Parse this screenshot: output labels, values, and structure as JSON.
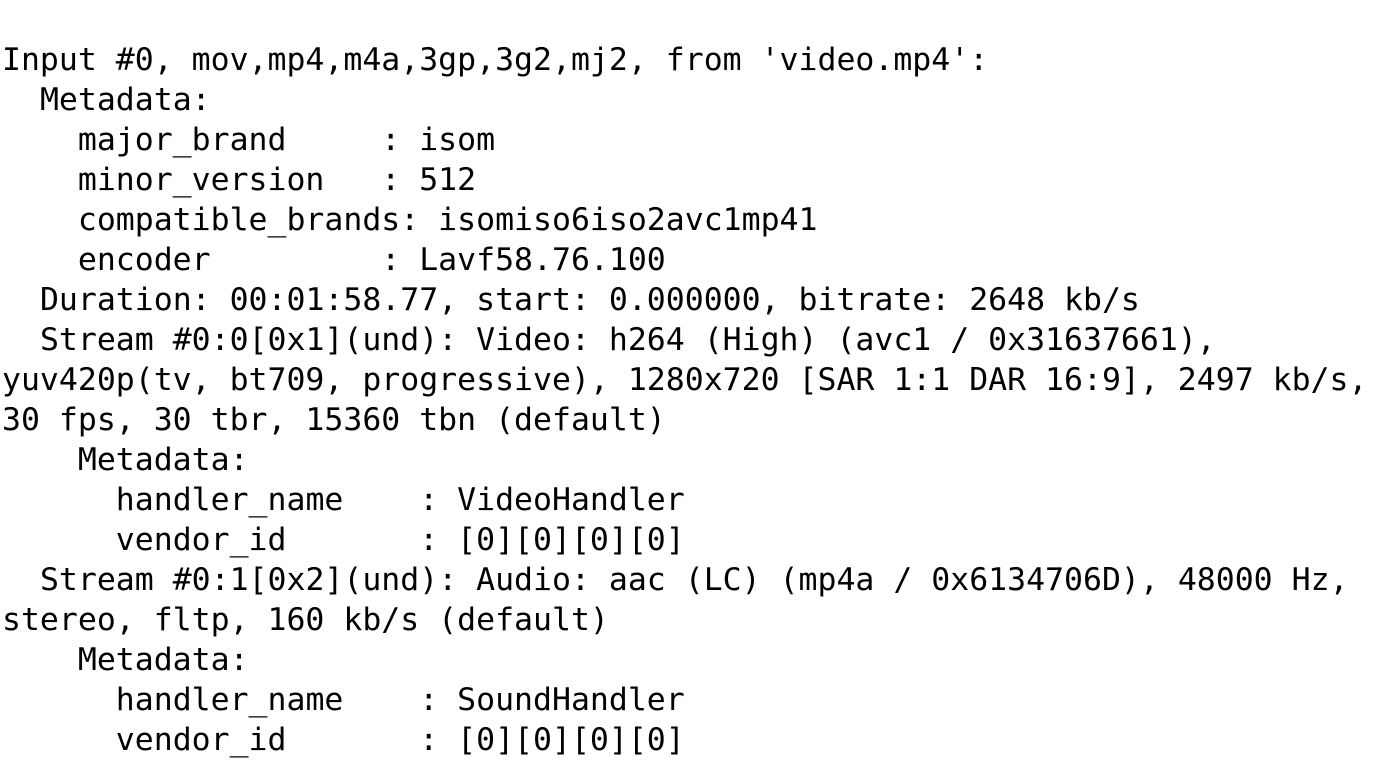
{
  "terminal": {
    "app": "ffprobe",
    "background_color": "#ffffff",
    "text_color": "#000000",
    "source_file": "video.mp4",
    "container_formats": "mov,mp4,m4a,3gp,3g2,mj2",
    "input_index": "#0",
    "lines": [
      "Input #0, mov,mp4,m4a,3gp,3g2,mj2, from 'video.mp4':",
      "  Metadata:",
      "    major_brand     : isom",
      "    minor_version   : 512",
      "    compatible_brands: isomiso6iso2avc1mp41",
      "    encoder         : Lavf58.76.100",
      "  Duration: 00:01:58.77, start: 0.000000, bitrate: 2648 kb/s",
      "  Stream #0:0[0x1](und): Video: h264 (High) (avc1 / 0x31637661), yuv420p(tv, bt709, progressive), 1280x720 [SAR 1:1 DAR 16:9], 2497 kb/s, 30 fps, 30 tbr, 15360 tbn (default)",
      "    Metadata:",
      "      handler_name    : VideoHandler",
      "      vendor_id       : [0][0][0][0]",
      "  Stream #0:1[0x2](und): Audio: aac (LC) (mp4a / 0x6134706D), 48000 Hz, stereo, fltp, 160 kb/s (default)",
      "    Metadata:",
      "      handler_name    : SoundHandler",
      "      vendor_id       : [0][0][0][0]"
    ],
    "metadata_container": {
      "major_brand": "isom",
      "minor_version": "512",
      "compatible_brands": "isomiso6iso2avc1mp41",
      "encoder": "Lavf58.76.100"
    },
    "duration": {
      "duration": "00:01:58.77",
      "start": "0.000000",
      "bitrate": "2648 kb/s"
    },
    "streams": [
      {
        "id": "#0:0[0x1](und)",
        "type": "Video",
        "codec": "h264 (High) (avc1 / 0x31637661)",
        "pixel_format": "yuv420p(tv, bt709, progressive)",
        "resolution": "1280x720",
        "aspect": "[SAR 1:1 DAR 16:9]",
        "bitrate": "2497 kb/s",
        "fps": "30 fps",
        "tbr": "30 tbr",
        "tbn": "15360 tbn",
        "disposition": "(default)",
        "metadata": {
          "handler_name": "VideoHandler",
          "vendor_id": "[0][0][0][0]"
        }
      },
      {
        "id": "#0:1[0x2](und)",
        "type": "Audio",
        "codec": "aac (LC) (mp4a / 0x6134706D)",
        "sample_rate": "48000 Hz",
        "channel_layout": "stereo",
        "sample_format": "fltp",
        "bitrate": "160 kb/s",
        "disposition": "(default)",
        "metadata": {
          "handler_name": "SoundHandler",
          "vendor_id": "[0][0][0][0]"
        }
      }
    ]
  }
}
